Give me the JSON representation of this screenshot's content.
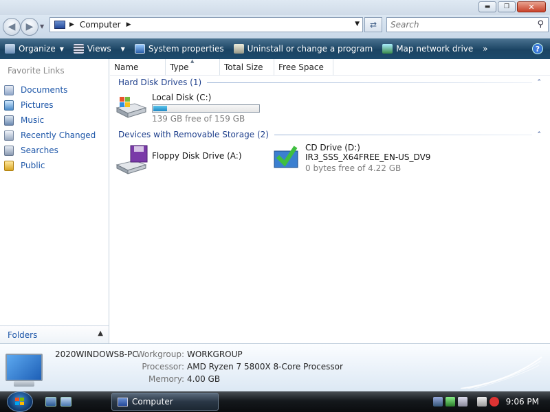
{
  "window": {
    "address": "Computer",
    "search_placeholder": "Search"
  },
  "toolbar": {
    "organize": "Organize",
    "views": "Views",
    "system_properties": "System properties",
    "uninstall": "Uninstall or change a program",
    "map_drive": "Map network drive",
    "more": "»"
  },
  "sidebar": {
    "title": "Favorite Links",
    "links": [
      "Documents",
      "Pictures",
      "Music",
      "Recently Changed",
      "Searches",
      "Public"
    ],
    "folders": "Folders"
  },
  "columns": [
    "Name",
    "Type",
    "Total Size",
    "Free Space"
  ],
  "groups": {
    "hard": "Hard Disk Drives (1)",
    "removable": "Devices with Removable Storage (2)"
  },
  "drives": {
    "local": {
      "name": "Local Disk (C:)",
      "free": "139 GB free of 159 GB",
      "used_fraction": 0.126
    },
    "floppy": {
      "name": "Floppy Disk Drive (A:)"
    },
    "cd": {
      "name": "CD Drive (D:)",
      "label": "IR3_SSS_X64FREE_EN-US_DV9",
      "free": "0 bytes free of 4.22 GB"
    }
  },
  "details": {
    "computer_name": "2020WINDOWS8-PC",
    "workgroup_label": "Workgroup:",
    "workgroup": "WORKGROUP",
    "processor_label": "Processor:",
    "processor": "AMD Ryzen 7 5800X 8-Core Processor",
    "memory_label": "Memory:",
    "memory": "4.00 GB"
  },
  "taskbar": {
    "task": "Computer",
    "clock": "9:06 PM"
  },
  "icons": [
    "back-icon",
    "forward-icon",
    "refresh-icon",
    "search-icon",
    "help-icon",
    "start-orb-icon"
  ]
}
